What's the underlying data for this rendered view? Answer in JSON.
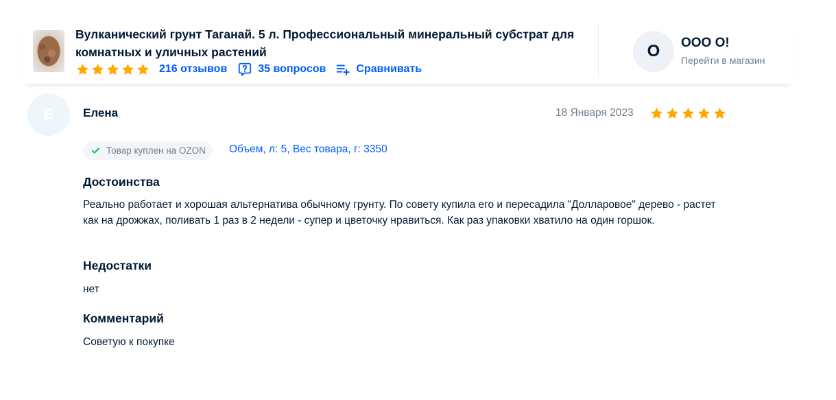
{
  "product": {
    "title": "Вулканический грунт Таганай. 5 л. Профессиональный минеральный субстрат для комнатных и уличных растений",
    "rating_stars": 5,
    "reviews_link": "216 отзывов",
    "questions_link": "35 вопросов",
    "compare_link": "Сравнивать",
    "icons": [
      "product-thumbnail",
      "star-icon",
      "question-bubble-icon",
      "compare-list-icon"
    ]
  },
  "seller": {
    "avatar_letter": "O",
    "name": "ООО О!",
    "subtitle": "Перейти в магазин"
  },
  "review": {
    "avatar_letter": "E",
    "author": "Елена",
    "date": "18 Января 2023",
    "rating_stars": 5,
    "purchased_badge": "Товар куплен на OZON",
    "variant": "Объем, л: 5, Вес товара, г: 3350",
    "pros_title": "Достоинства",
    "pros_text": "Реально работает и хорошая альтернатива обычному грунту. По совету купила его и пересадила \"Долларовое\" дерево - растет как на дрожжах, поливать 1 раз в 2 недели - супер и цветочку нравиться. Как раз упаковки хватило на один горшок.",
    "cons_title": "Недостатки",
    "cons_text": "нет",
    "comment_title": "Комментарий",
    "comment_text": "Советую к покупке"
  },
  "colors": {
    "link_blue": "#005bff",
    "star_orange": "#ffa800",
    "text_dark": "#001a34",
    "text_gray": "#707f8d",
    "check_green": "#10c44c"
  }
}
